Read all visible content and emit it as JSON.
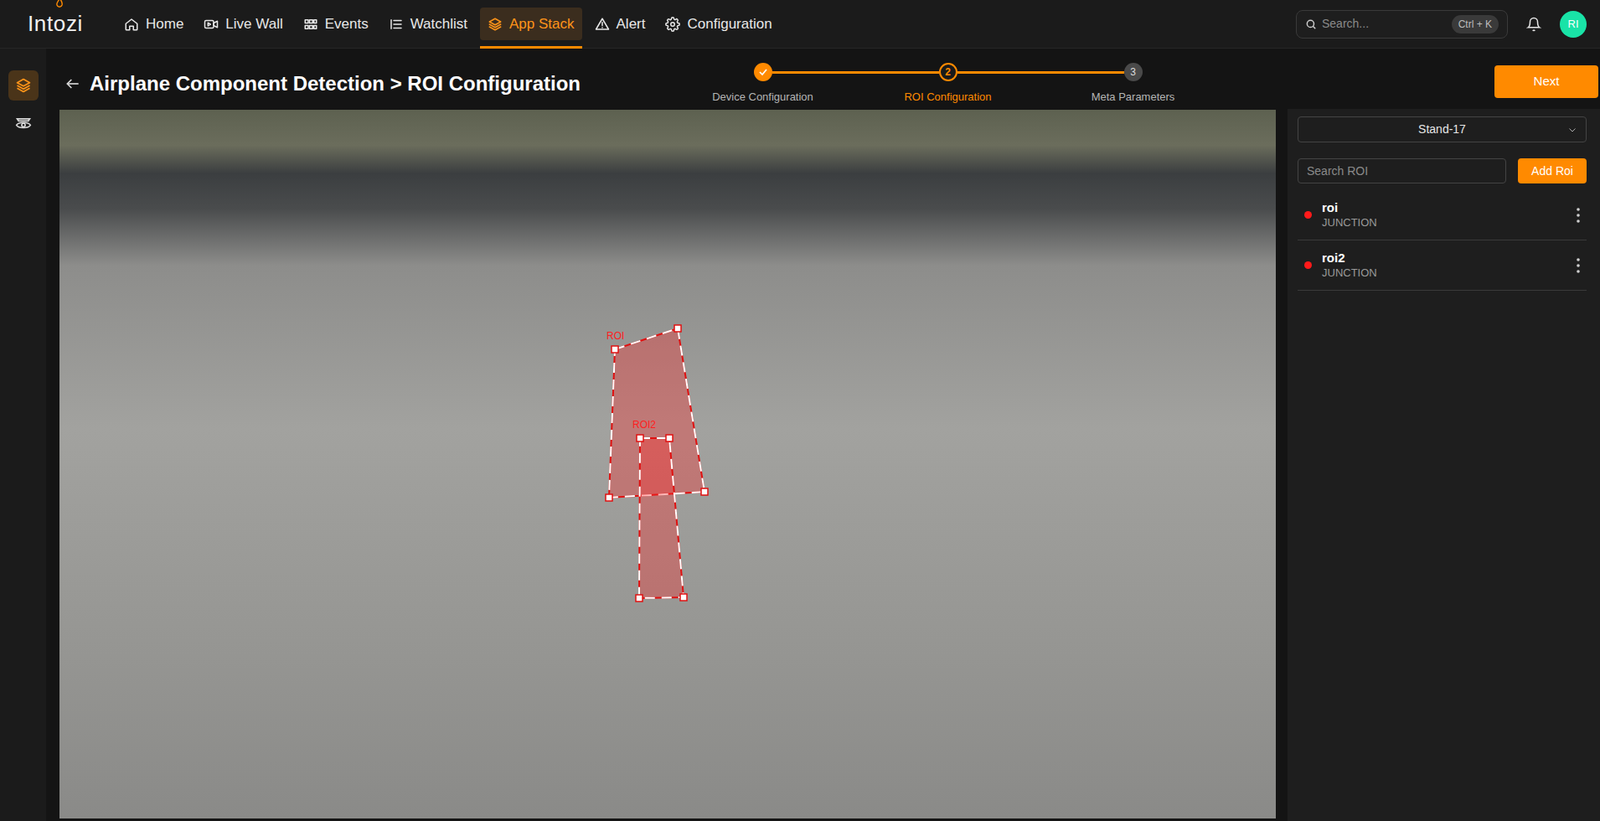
{
  "app": {
    "logo": "Intozi"
  },
  "nav": [
    {
      "label": "Home",
      "selected": false
    },
    {
      "label": "Live Wall",
      "selected": false
    },
    {
      "label": "Events",
      "selected": false
    },
    {
      "label": "Watchlist",
      "selected": false
    },
    {
      "label": "App Stack",
      "selected": true
    },
    {
      "label": "Alert",
      "selected": false
    },
    {
      "label": "Configuration",
      "selected": false
    }
  ],
  "search": {
    "placeholder": "Search...",
    "shortcut": "Ctrl + K"
  },
  "user": {
    "initials": "RI"
  },
  "sidebar": [
    {
      "selected": true
    },
    {
      "selected": false
    }
  ],
  "header": {
    "title": "Airplane Component Detection > ROI Configuration"
  },
  "steps": [
    {
      "label": "Device Configuration",
      "kind": "done"
    },
    {
      "number": "2",
      "label": "ROI Configuration",
      "kind": "active"
    },
    {
      "number": "3",
      "label": "Meta Parameters",
      "kind": "pending"
    }
  ],
  "next_button": "Next",
  "camera_select": {
    "value": "Stand-17"
  },
  "roi_search": {
    "placeholder": "Search ROI"
  },
  "add_roi_button": "Add Roi",
  "rois": [
    {
      "name": "roi",
      "type": "JUNCTION"
    },
    {
      "name": "roi2",
      "type": "JUNCTION"
    }
  ],
  "overlays": [
    {
      "label": "ROI"
    },
    {
      "label": "ROI2"
    }
  ]
}
